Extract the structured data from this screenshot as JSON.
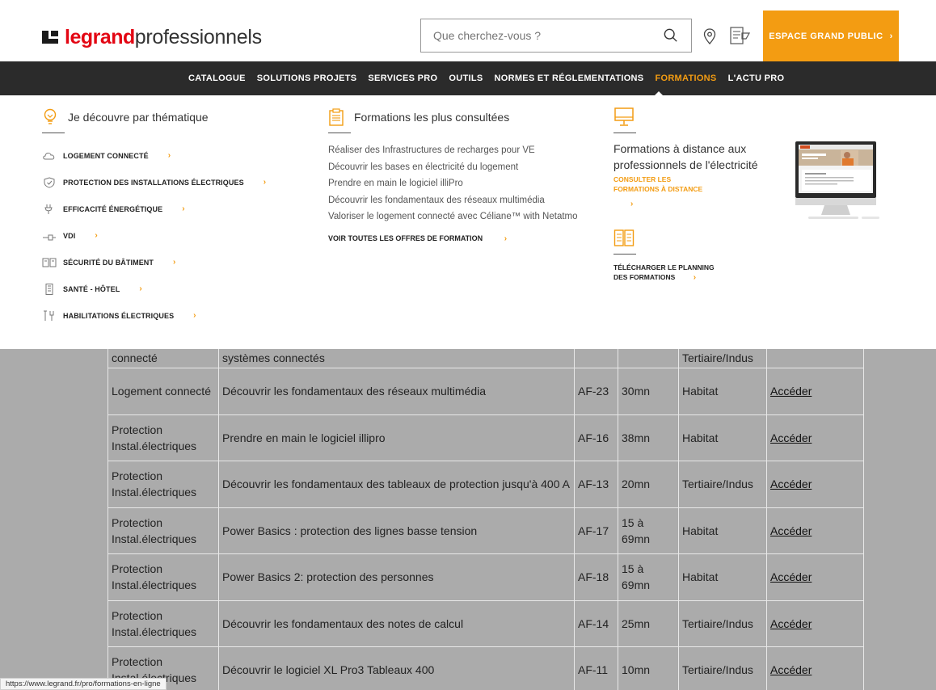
{
  "header": {
    "brand": "legrand",
    "brand_sub": "professionnels",
    "search_placeholder": "Que cherchez-vous ?",
    "grand_public_label": "ESPACE GRAND PUBLIC",
    "grand_public_chevron": "›",
    "accent_color": "#f39c12",
    "brand_color": "#e30613"
  },
  "nav": {
    "items": [
      {
        "label": "CATALOGUE"
      },
      {
        "label": "SOLUTIONS PROJETS"
      },
      {
        "label": "SERVICES PRO"
      },
      {
        "label": "OUTILS"
      },
      {
        "label": "NORMES ET RÉGLEMENTATIONS"
      },
      {
        "label": "FORMATIONS"
      },
      {
        "label": "L'ACTU PRO"
      }
    ],
    "active": "FORMATIONS"
  },
  "menu": {
    "themes_title": "Je découvre par thématique",
    "themes": [
      {
        "label": "LOGEMENT CONNECTÉ",
        "icon": "cloud-icon"
      },
      {
        "label": "PROTECTION DES INSTALLATIONS ÉLECTRIQUES",
        "icon": "shield-icon"
      },
      {
        "label": "EFFICACITÉ ÉNERGÉTIQUE",
        "icon": "plug-icon"
      },
      {
        "label": "VDI",
        "icon": "cable-icon"
      },
      {
        "label": "SÉCURITÉ DU BÂTIMENT",
        "icon": "alarm-panel-icon"
      },
      {
        "label": "SANTÉ - HÔTEL",
        "icon": "door-panel-icon"
      },
      {
        "label": "HABILITATIONS ÉLECTRIQUES",
        "icon": "tools-icon"
      }
    ],
    "chevron": "›",
    "popular_title": "Formations les plus consultées",
    "popular": [
      "Réaliser des Infrastructures de recharges pour VE",
      "Découvrir les bases en électricité du logement",
      "Prendre en main le logiciel illiPro",
      "Découvrir les fondamentaux des réseaux multimédia",
      "Valoriser le logement connecté avec Céliane™ with Netatmo"
    ],
    "all_offers": "VOIR TOUTES LES OFFRES DE FORMATION",
    "distance_title": "Formations à distance aux professionnels de l'électricité",
    "distance_link_1": "CONSULTER LES",
    "distance_link_2": "FORMATIONS À DISTANCE",
    "planning_1": "TÉLÉCHARGER LE PLANNING",
    "planning_2": "DES FORMATIONS"
  },
  "table": {
    "rows": [
      {
        "theme": "connecté",
        "title": "systèmes connectés",
        "code": "",
        "duration": "",
        "market": "Tertiaire/Indus",
        "access": ""
      },
      {
        "theme": "Logement connecté",
        "title": "Découvrir les fondamentaux des réseaux multimédia",
        "code": "AF-23",
        "duration": "30mn",
        "market": "Habitat",
        "access": "Accéder"
      },
      {
        "theme": "Protection Instal.électriques",
        "title": "Prendre en main le logiciel illipro",
        "code": "AF-16",
        "duration": "38mn",
        "market": "Habitat",
        "access": "Accéder"
      },
      {
        "theme": "Protection Instal.électriques",
        "title": "Découvrir les fondamentaux des tableaux de protection jusqu'à 400 A",
        "code": "AF-13",
        "duration": "20mn",
        "market": "Tertiaire/Indus",
        "access": "Accéder"
      },
      {
        "theme": "Protection Instal.électriques",
        "title": "Power Basics : protection des lignes basse tension",
        "code": "AF-17",
        "duration": "15 à 69mn",
        "market": "Habitat",
        "access": "Accéder"
      },
      {
        "theme": "Protection Instal.électriques",
        "title": "Power Basics 2: protection des personnes",
        "code": "AF-18",
        "duration": "15 à 69mn",
        "market": "Habitat",
        "access": "Accéder"
      },
      {
        "theme": "Protection Instal.électriques",
        "title": "Découvrir les fondamentaux des notes de calcul",
        "code": "AF-14",
        "duration": "25mn",
        "market": "Tertiaire/Indus",
        "access": "Accéder"
      },
      {
        "theme": "Protection Instal.électriques",
        "title": "Découvrir le logiciel XL Pro3 Tableaux 400",
        "code": "AF-11",
        "duration": "10mn",
        "market": "Tertiaire/Indus",
        "access": "Accéder"
      }
    ]
  },
  "status_url": "https://www.legrand.fr/pro/formations-en-ligne"
}
